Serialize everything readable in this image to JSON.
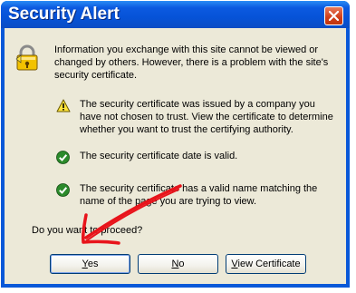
{
  "dialog": {
    "title": "Security Alert",
    "intro": "Information you exchange with this site cannot be viewed or changed by others. However, there is a problem with the site's security certificate.",
    "items": [
      {
        "icon": "warning-icon",
        "text": "The security certificate was issued by a company you have not chosen to trust. View the certificate to determine whether you want to trust the certifying authority."
      },
      {
        "icon": "check-icon",
        "text": "The security certificate date is valid."
      },
      {
        "icon": "check-icon",
        "text": "The security certificate has a valid name matching the name of the page you are trying to view."
      }
    ],
    "question": "Do you want to proceed?",
    "buttons": {
      "yes_first": "Y",
      "yes_rest": "es",
      "no_first": "N",
      "no_rest": "o",
      "view_first": "V",
      "view_rest": "iew Certificate"
    }
  },
  "colors": {
    "titlebar": "#0653d8",
    "client_bg": "#ece9d8",
    "close_button": "#cf3c17",
    "warning_yellow": "#ffe43a",
    "check_green": "#2b8a2b",
    "annotation_arrow": "#e8141b"
  }
}
